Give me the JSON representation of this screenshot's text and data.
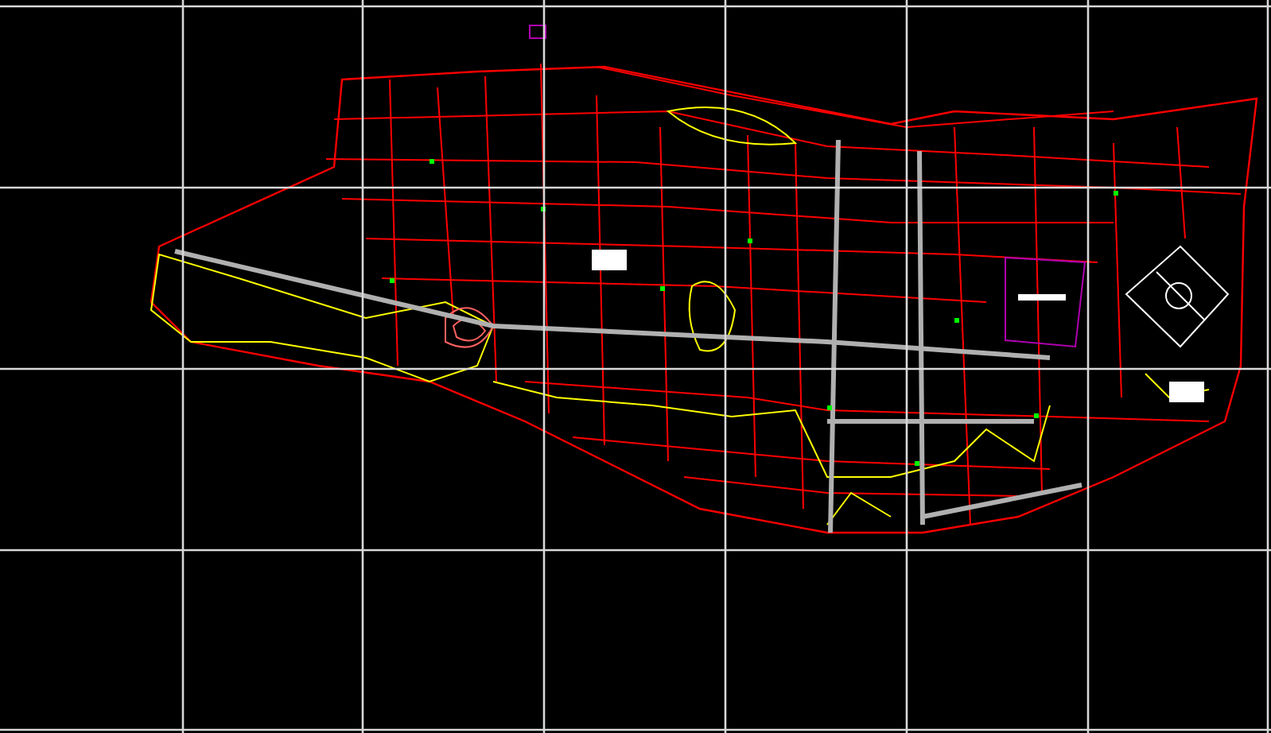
{
  "grid_lines": [
    {
      "kind": "horizontal"
    },
    {
      "kind": "horizontal"
    },
    {
      "kind": "horizontal"
    },
    {
      "kind": "horizontal"
    },
    {
      "kind": "horizontal"
    },
    {
      "kind": "vertical"
    },
    {
      "kind": "vertical"
    },
    {
      "kind": "vertical"
    },
    {
      "kind": "vertical"
    },
    {
      "kind": "vertical"
    },
    {
      "kind": "vertical"
    },
    {
      "kind": "vertical"
    }
  ]
}
